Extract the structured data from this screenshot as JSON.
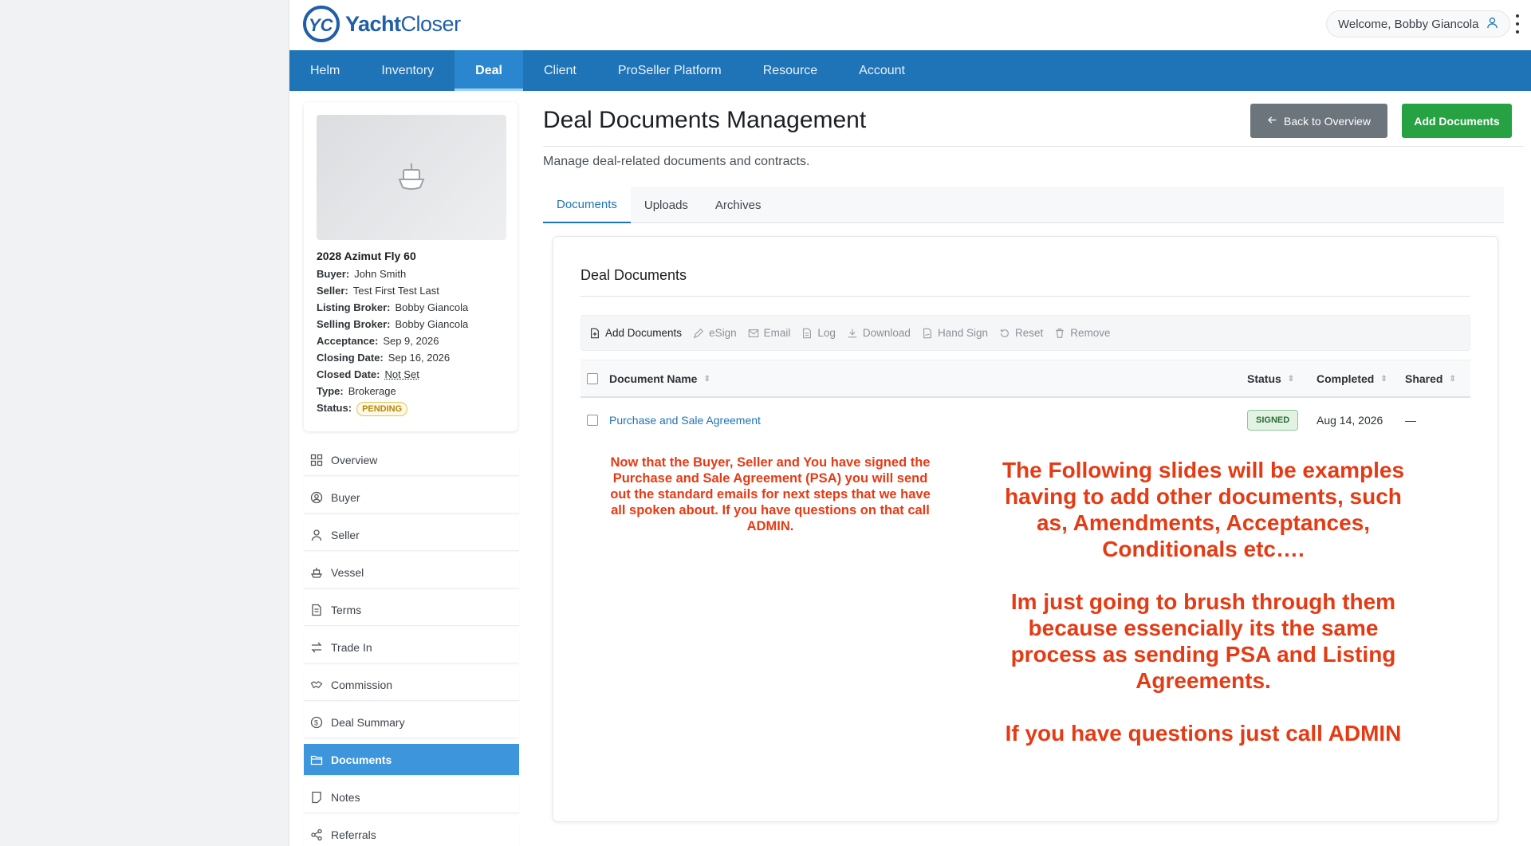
{
  "header": {
    "logo_mark": "YC",
    "logo_bold": "Yacht",
    "logo_light": "Closer",
    "welcome": "Welcome, Bobby Giancola"
  },
  "nav": {
    "items": [
      {
        "label": "Helm"
      },
      {
        "label": "Inventory"
      },
      {
        "label": "Deal",
        "active": true
      },
      {
        "label": "Client"
      },
      {
        "label": "ProSeller Platform"
      },
      {
        "label": "Resource"
      },
      {
        "label": "Account"
      }
    ]
  },
  "vessel": {
    "title": "2028 Azimut Fly 60",
    "fields": [
      {
        "label": "Buyer:",
        "value": "John Smith"
      },
      {
        "label": "Seller:",
        "value": "Test First Test Last"
      },
      {
        "label": "Listing Broker:",
        "value": "Bobby Giancola"
      },
      {
        "label": "Selling Broker:",
        "value": "Bobby Giancola"
      },
      {
        "label": "Acceptance:",
        "value": "Sep 9, 2026"
      },
      {
        "label": "Closing Date:",
        "value": "Sep 16, 2026"
      },
      {
        "label": "Closed Date:",
        "value": "Not Set"
      },
      {
        "label": "Type:",
        "value": "Brokerage"
      },
      {
        "label": "Status:",
        "value": "PENDING"
      }
    ]
  },
  "sidebar": {
    "items": [
      {
        "label": "Overview",
        "icon": "grid-icon"
      },
      {
        "label": "Buyer",
        "icon": "user-circle-icon"
      },
      {
        "label": "Seller",
        "icon": "user-icon"
      },
      {
        "label": "Vessel",
        "icon": "ship-icon"
      },
      {
        "label": "Terms",
        "icon": "document-icon"
      },
      {
        "label": "Trade In",
        "icon": "swap-icon"
      },
      {
        "label": "Commission",
        "icon": "handshake-icon"
      },
      {
        "label": "Deal Summary",
        "icon": "dollar-icon"
      },
      {
        "label": "Documents",
        "icon": "folder-open-icon",
        "active": true
      },
      {
        "label": "Notes",
        "icon": "note-icon"
      },
      {
        "label": "Referrals",
        "icon": "share-icon"
      }
    ]
  },
  "main": {
    "title": "Deal Documents Management",
    "subtitle": "Manage deal-related documents and contracts.",
    "back_button": "Back to Overview",
    "add_button": "Add Documents",
    "tabs": [
      {
        "label": "Documents",
        "active": true
      },
      {
        "label": "Uploads"
      },
      {
        "label": "Archives"
      }
    ]
  },
  "documents": {
    "card_title": "Deal Documents",
    "toolbar": [
      {
        "label": "Add Documents",
        "icon": "file-plus-icon",
        "enabled": true
      },
      {
        "label": "eSign",
        "icon": "pen-icon"
      },
      {
        "label": "Email",
        "icon": "mail-icon"
      },
      {
        "label": "Log",
        "icon": "log-icon"
      },
      {
        "label": "Download",
        "icon": "download-icon"
      },
      {
        "label": "Hand Sign",
        "icon": "hand-sign-icon"
      },
      {
        "label": "Reset",
        "icon": "reset-icon"
      },
      {
        "label": "Remove",
        "icon": "trash-icon"
      }
    ],
    "columns": {
      "name": "Document Name",
      "status": "Status",
      "completed": "Completed",
      "shared": "Shared"
    },
    "rows": [
      {
        "name": "Purchase and Sale Agreement",
        "status": "SIGNED",
        "completed": "Aug 14, 2026",
        "shared": "—"
      }
    ]
  },
  "annotations": {
    "left": "Now that the Buyer, Seller and You have signed the Purchase and Sale Agreement (PSA) you will send out the standard emails for next steps that we have all spoken about. If you have questions on that call ADMIN.",
    "right_1": "The Following slides will be examples having to add other documents, such as, Amendments, Acceptances, Conditionals etc….",
    "right_2": "Im just going to brush through them because essencially its the same process as sending PSA and Listing Agreements.",
    "right_3": "If you have questions just call ADMIN"
  },
  "colors": {
    "nav_bg": "#1f73b7",
    "accent": "#1f73b7",
    "add_button": "#27a243",
    "back_button": "#6c747c",
    "sidebar_active": "#3d96db",
    "annotation": "#e53b14"
  }
}
